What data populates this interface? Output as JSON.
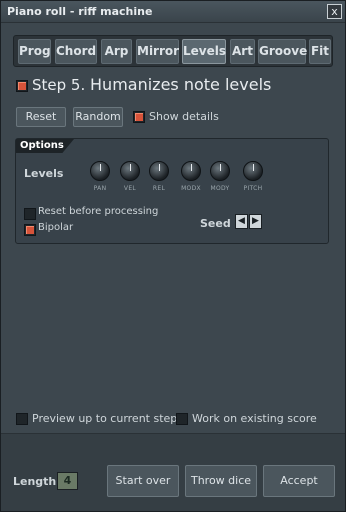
{
  "window": {
    "title": "Piano roll - riff machine",
    "close_symbol": "x"
  },
  "tabs": [
    {
      "label": "Prog"
    },
    {
      "label": "Chord"
    },
    {
      "label": "Arp"
    },
    {
      "label": "Mirror"
    },
    {
      "label": "Levels",
      "active": true
    },
    {
      "label": "Art"
    },
    {
      "label": "Groove"
    },
    {
      "label": "Fit"
    }
  ],
  "step": {
    "prefix": "Step 5.",
    "title": "Humanizes note levels",
    "checked": true
  },
  "controls": {
    "reset_label": "Reset",
    "random_label": "Random",
    "show_details_label": "Show details",
    "show_details_checked": true
  },
  "options": {
    "header": "Options",
    "levels_label": "Levels",
    "knobs": [
      {
        "label": "PAN"
      },
      {
        "label": "VEL"
      },
      {
        "label": "REL"
      },
      {
        "label": "MODX"
      },
      {
        "label": "MODY"
      },
      {
        "label": "PITCH"
      }
    ],
    "reset_before_label": "Reset before processing",
    "reset_before_checked": false,
    "bipolar_label": "Bipolar",
    "bipolar_checked": true,
    "seed_label": "Seed",
    "seed_prev": "◀",
    "seed_next": "▶"
  },
  "footer_checks": {
    "preview_label": "Preview up to current step",
    "preview_checked": false,
    "work_existing_label": "Work on existing score",
    "work_existing_checked": false
  },
  "bottom": {
    "length_label": "Length",
    "length_value": "4",
    "start_over_label": "Start over",
    "throw_dice_label": "Throw dice",
    "accept_label": "Accept"
  }
}
